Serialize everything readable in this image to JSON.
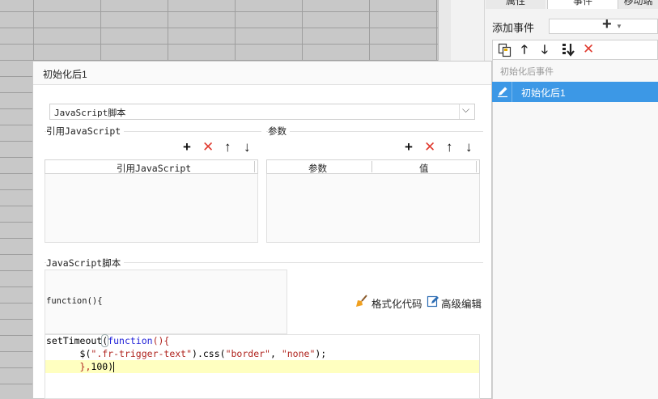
{
  "right_panel": {
    "tabs": [
      "属性",
      "事件",
      "移动端"
    ],
    "add_event_label": "添加事件",
    "add_event_button": "+",
    "event_group_label": "初始化后事件",
    "events": [
      "初始化后1"
    ]
  },
  "dialog": {
    "title": "初始化后1",
    "script_type_select": "JavaScript脚本",
    "ref_js_section": "引用JavaScript",
    "ref_js_column": "引用JavaScript",
    "params_section": "参数",
    "params_columns": [
      "参数",
      "值"
    ],
    "script_section": "JavaScript脚本",
    "function_header": "function(){",
    "format_code_label": "格式化代码",
    "advanced_edit_label": "高级编辑",
    "code": {
      "line1_fn": "setTimeout",
      "line1_paren_open": "(",
      "line1_kw": "function",
      "line1_rest": "(){",
      "line2_indent": "      ",
      "line2_a": "$(",
      "line2_str1": "\".fr-trigger-text\"",
      "line2_b": ").css(",
      "line2_str2": "\"border\"",
      "line2_c": ", ",
      "line2_str3": "\"none\"",
      "line2_d": ");",
      "line3_indent": "      ",
      "line3_a": "},",
      "line3_num": "100",
      "line3_b": ")"
    }
  },
  "colors": {
    "selection_blue": "#3c98e6",
    "delete_red": "#e03b30",
    "keyword_blue": "#2323d9",
    "string_red": "#b0241f",
    "current_line": "#ffffc0"
  }
}
